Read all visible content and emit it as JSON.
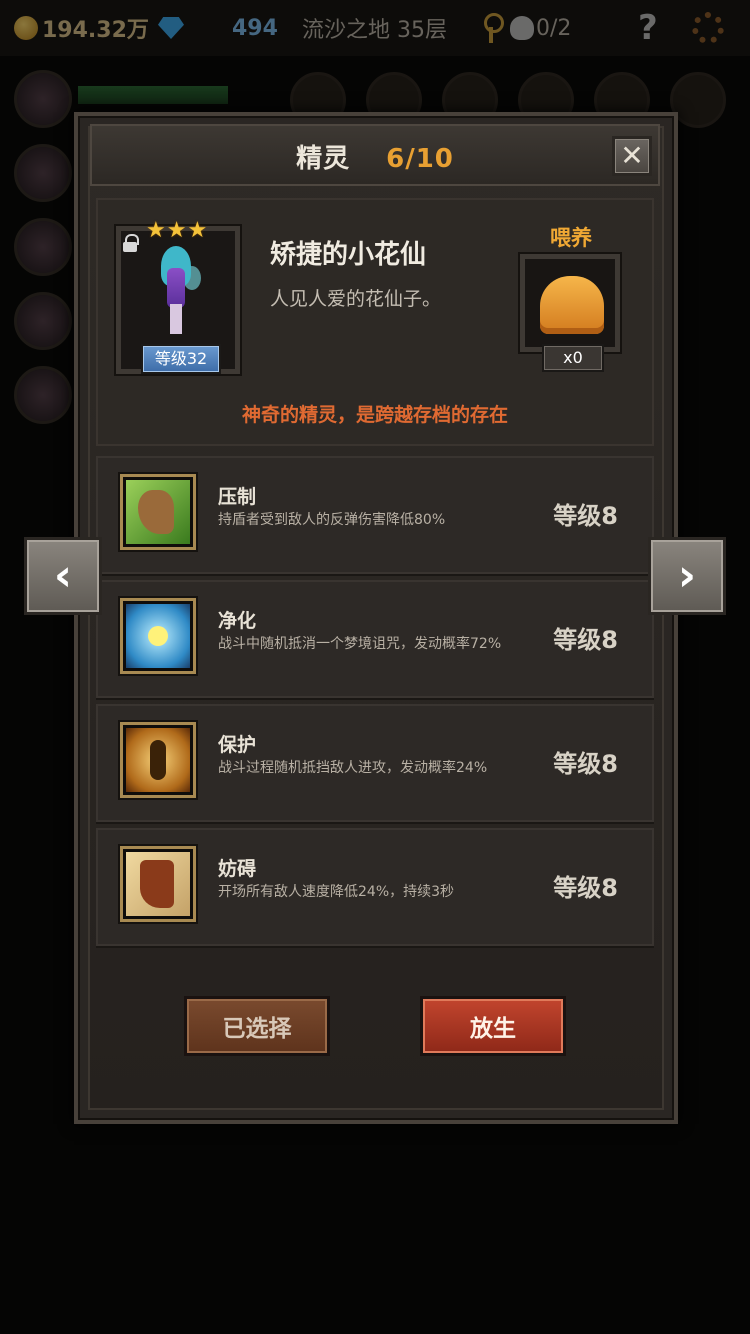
{
  "topbar": {
    "gold": "194.32万",
    "gems": "494",
    "location": "流沙之地 35层",
    "skull_count": "0/2",
    "help": "?"
  },
  "modal": {
    "title": "精灵",
    "count": "6/10",
    "close": "✕"
  },
  "spirit": {
    "name": "矫捷的小花仙",
    "description": "人见人爱的花仙子。",
    "level": "等级32",
    "stars": 3,
    "star_glyph": "★",
    "locked": true,
    "tagline": "神奇的精灵，是跨越存档的存在"
  },
  "feed": {
    "label": "喂养",
    "count": "x0",
    "item_icon": "bread-icon"
  },
  "skills": [
    {
      "name": "压制",
      "desc": "持盾者受到敌人的反弹伤害降低80%",
      "level": "等级8",
      "icon": "claw-icon"
    },
    {
      "name": "净化",
      "desc": "战斗中随机抵消一个梦境诅咒，发动概率72%",
      "level": "等级8",
      "icon": "flower-icon"
    },
    {
      "name": "保护",
      "desc": "战斗过程随机抵挡敌人进攻，发动概率24%",
      "level": "等级8",
      "icon": "fairy-icon"
    },
    {
      "name": "妨碍",
      "desc": "开场所有敌人速度降低24%，持续3秒",
      "level": "等级8",
      "icon": "boot-icon"
    }
  ],
  "nav": {
    "prev": "‹",
    "next": "›"
  },
  "buttons": {
    "selected": "已选择",
    "release": "放生"
  },
  "colors": {
    "accent_orange": "#e8a032",
    "tagline_orange": "#e06a32",
    "release_red": "#b23a24",
    "level_blue": "#4f7fbc"
  }
}
